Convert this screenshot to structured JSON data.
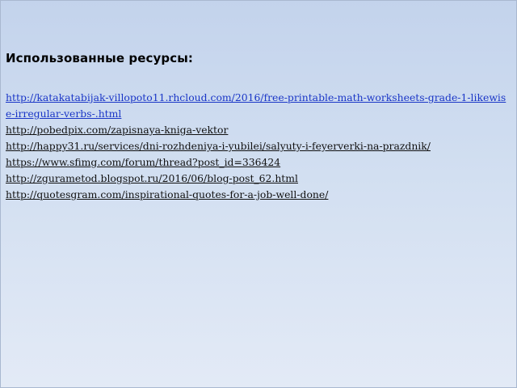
{
  "title": "Использованные ресурсы:",
  "links": [
    "http://katakatabijak-villopoto11.rhcloud.com/2016/free-printable-math-worksheets-grade-1-likewise-irregular-verbs-.html",
    "http://pobedpix.com/zapisnaya-kniga-vektor",
    "http://happy31.ru/services/dni-rozhdeniya-i-yubilei/salyuty-i-feyerverki-na-prazdnik/",
    "https://www.sfimg.com/forum/thread?post_id=336424",
    "http://zgurametod.blogspot.ru/2016/06/blog-post_62.html",
    "http://quotesgram.com/inspirational-quotes-for-a-job-well-done/"
  ],
  "colors": {
    "visited_link": "#1a36c7",
    "link": "#111111"
  }
}
